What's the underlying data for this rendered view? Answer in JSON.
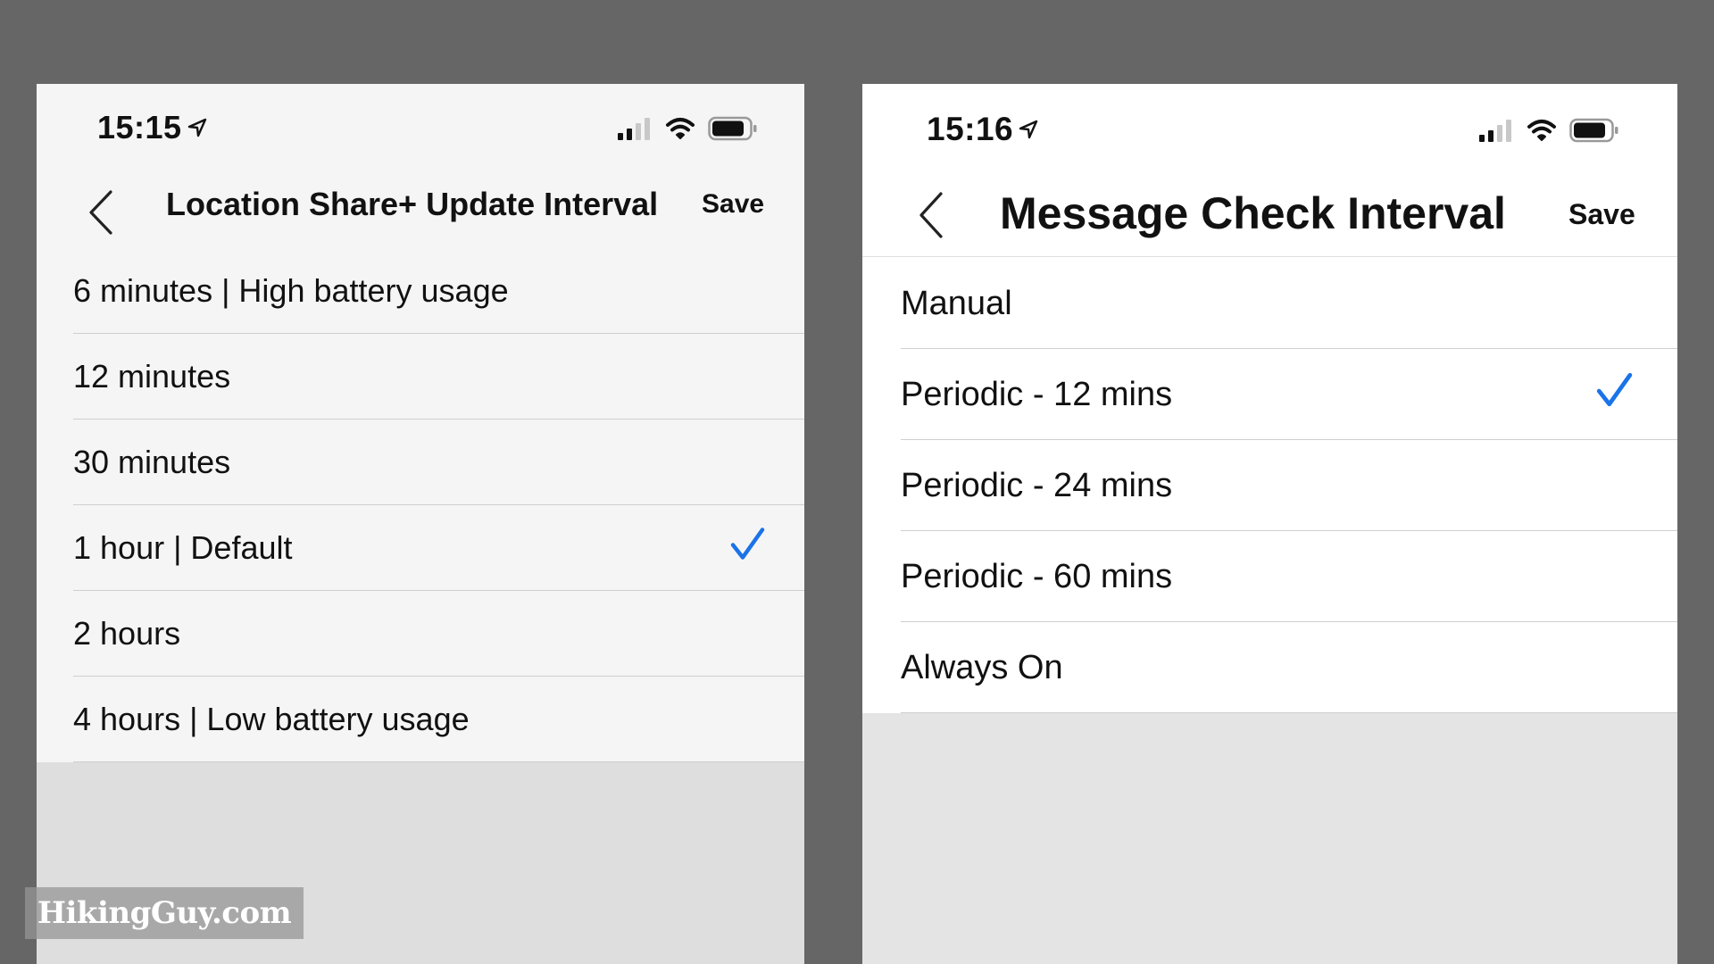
{
  "left": {
    "status": {
      "time": "15:15"
    },
    "nav": {
      "title": "Location Share+ Update Interval",
      "save_label": "Save"
    },
    "options": [
      {
        "label": "6 minutes | High battery usage",
        "selected": false
      },
      {
        "label": "12 minutes",
        "selected": false
      },
      {
        "label": "30 minutes",
        "selected": false
      },
      {
        "label": "1 hour | Default",
        "selected": true
      },
      {
        "label": "2 hours",
        "selected": false
      },
      {
        "label": "4 hours | Low battery usage",
        "selected": false
      }
    ]
  },
  "right": {
    "status": {
      "time": "15:16"
    },
    "nav": {
      "title": "Message Check Interval",
      "save_label": "Save"
    },
    "options": [
      {
        "label": "Manual",
        "selected": false
      },
      {
        "label": "Periodic - 12 mins",
        "selected": true
      },
      {
        "label": "Periodic - 24 mins",
        "selected": false
      },
      {
        "label": "Periodic - 60 mins",
        "selected": false
      },
      {
        "label": "Always On",
        "selected": false
      }
    ]
  },
  "watermark": {
    "text": "HikingGuy.com"
  },
  "colors": {
    "accent": "#1a73e8",
    "frame": "#666666"
  },
  "icons": [
    "location-arrow-icon",
    "signal-icon",
    "wifi-icon",
    "battery-icon",
    "back-chevron-icon",
    "checkmark-icon"
  ]
}
